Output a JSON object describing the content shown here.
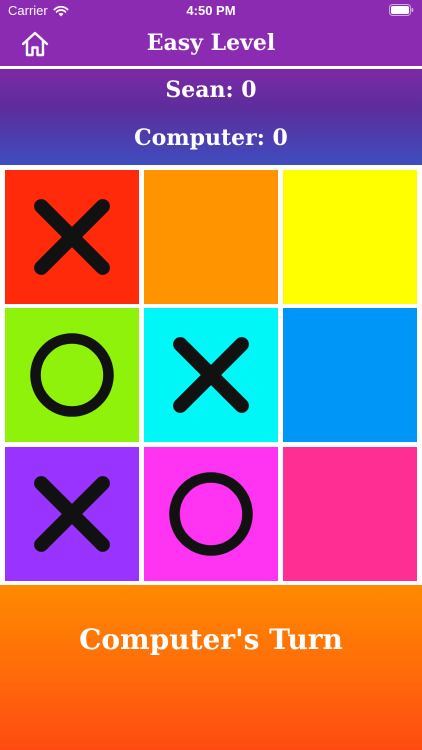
{
  "status": {
    "carrier": "Carrier",
    "time": "4:50 PM",
    "icons": [
      "wifi-icon",
      "battery-icon"
    ]
  },
  "header": {
    "title": "Easy Level",
    "home_icon": "home-icon"
  },
  "scores": {
    "player": "Sean: 0",
    "computer": "Computer: 0"
  },
  "board": {
    "cells": [
      {
        "color": "#ff2a0a",
        "mark": "X"
      },
      {
        "color": "#ff9400",
        "mark": ""
      },
      {
        "color": "#ffff00",
        "mark": ""
      },
      {
        "color": "#8ff20a",
        "mark": "O"
      },
      {
        "color": "#00f7f7",
        "mark": "X"
      },
      {
        "color": "#0096f7",
        "mark": ""
      },
      {
        "color": "#9933ff",
        "mark": "X"
      },
      {
        "color": "#ff33f2",
        "mark": "O"
      },
      {
        "color": "#ff2e93",
        "mark": ""
      }
    ]
  },
  "turn": {
    "text": "Computer's Turn"
  },
  "colors": {
    "header": "#8a2bb2",
    "mark": "#111111"
  }
}
